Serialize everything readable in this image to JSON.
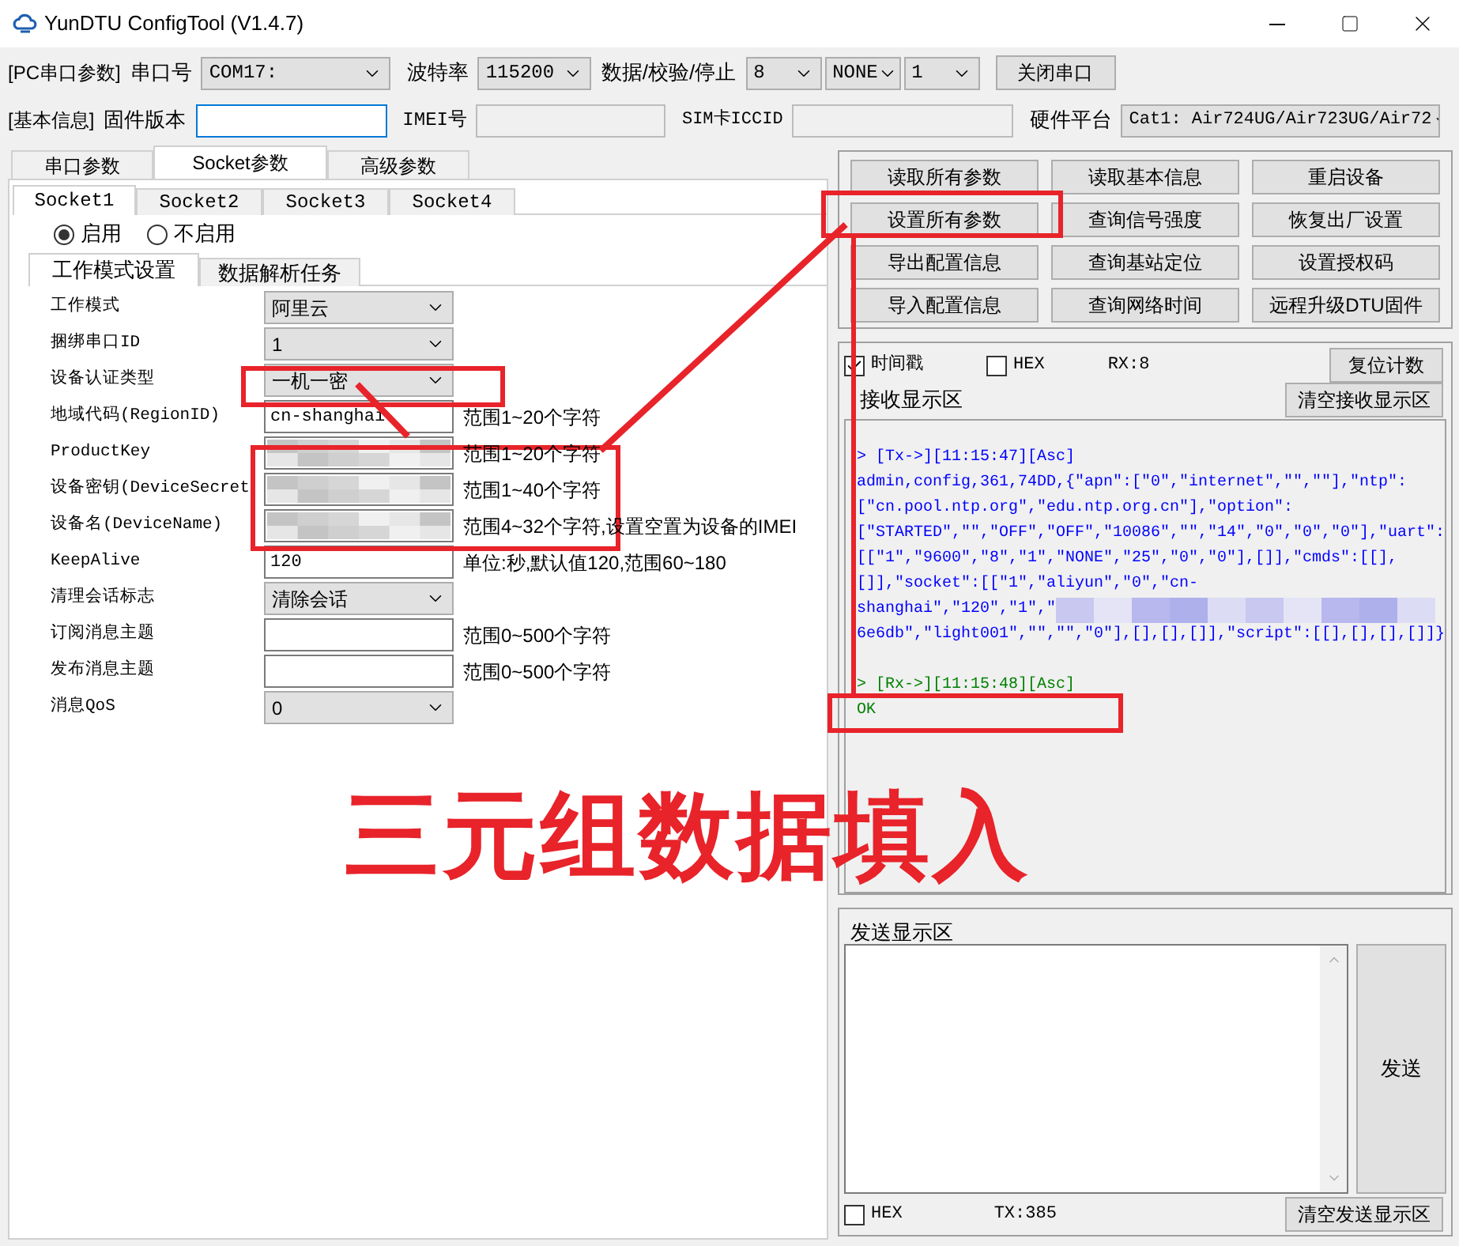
{
  "window": {
    "title": "YunDTU ConfigTool (V1.4.7)"
  },
  "serial_bar": {
    "section": "[PC串口参数]",
    "port_label": "串口号",
    "port": "COM17:",
    "baud_label": "波特率",
    "baud": "115200",
    "frame_label": "数据/校验/停止",
    "data_bits": "8",
    "parity": "NONE",
    "stop_bits": "1",
    "button": "关闭串口"
  },
  "info_bar": {
    "section": "[基本信息]",
    "firmware_label": "固件版本",
    "imei_label": "IMEI号",
    "iccid_label": "SIM卡ICCID",
    "platform_label": "硬件平台",
    "platform": "Cat1: Air724UG/Air723UG/Air72"
  },
  "main_tabs": [
    {
      "label": "串口参数",
      "selected": false
    },
    {
      "label": "Socket参数",
      "selected": true
    },
    {
      "label": "高级参数",
      "selected": false
    }
  ],
  "socket_tabs": [
    {
      "label": "Socket1",
      "selected": true
    },
    {
      "label": "Socket2",
      "selected": false
    },
    {
      "label": "Socket3",
      "selected": false
    },
    {
      "label": "Socket4",
      "selected": false
    }
  ],
  "enable_radios": [
    {
      "label": "启用",
      "selected": true
    },
    {
      "label": "不启用",
      "selected": false
    }
  ],
  "sub_tabs": [
    {
      "label": "工作模式设置",
      "selected": true
    },
    {
      "label": "数据解析任务",
      "selected": false
    }
  ],
  "form": [
    {
      "kind": "select",
      "label": "工作模式",
      "value": "阿里云"
    },
    {
      "kind": "select",
      "label": "捆绑串口ID",
      "value": "1"
    },
    {
      "kind": "select",
      "label": "设备认证类型",
      "value": "一机一密"
    },
    {
      "kind": "input",
      "label": "地域代码(RegionID)",
      "value": "cn-shanghai",
      "hint": "范围1~20个字符"
    },
    {
      "kind": "input",
      "label": "ProductKey",
      "blurred": true,
      "hint": "范围1~20个字符"
    },
    {
      "kind": "input",
      "label": "设备密钥(DeviceSecret",
      "blurred": true,
      "hint": "范围1~40个字符"
    },
    {
      "kind": "input",
      "label": "设备名(DeviceName)",
      "blurred": true,
      "hint": "范围4~32个字符,设置空置为设备的IMEI"
    },
    {
      "kind": "input",
      "label": "KeepAlive",
      "value": "120",
      "hint": "单位:秒,默认值120,范围60~180"
    },
    {
      "kind": "select",
      "label": "清理会话标志",
      "value": "清除会话"
    },
    {
      "kind": "input",
      "label": "订阅消息主题",
      "hint": "范围0~500个字符"
    },
    {
      "kind": "input",
      "label": "发布消息主题",
      "hint": "范围0~500个字符"
    },
    {
      "kind": "select",
      "label": "消息QoS",
      "value": "0"
    }
  ],
  "action_buttons": [
    "读取所有参数",
    "读取基本信息",
    "重启设备",
    "设置所有参数",
    "查询信号强度",
    "恢复出厂设置",
    "导出配置信息",
    "查询基站定位",
    "设置授权码",
    "导入配置信息",
    "查询网络时间",
    "远程升级DTU固件"
  ],
  "receive": {
    "timestamp": {
      "label": "时间戳",
      "checked": true
    },
    "hex": {
      "label": "HEX",
      "checked": false
    },
    "rx": "RX:8",
    "reset_button": "复位计数",
    "title": "接收显示区",
    "clear_button": "清空接收显示区",
    "log": [
      {
        "kind": "tx",
        "text": "> [Tx->][11:15:47][Asc]"
      },
      {
        "kind": "tx",
        "text": "admin,config,361,74DD,{\"apn\":[\"0\",\"internet\",\"\",\"\"],\"ntp\":"
      },
      {
        "kind": "tx",
        "text": "[\"cn.pool.ntp.org\",\"edu.ntp.org.cn\"],\"option\":"
      },
      {
        "kind": "tx",
        "text": "[\"STARTED\",\"\",\"OFF\",\"OFF\",\"10086\",\"\",\"14\",\"0\",\"0\",\"0\"],\"uart\":"
      },
      {
        "kind": "tx",
        "text": "[[\"1\",\"9600\",\"8\",\"1\",\"NONE\",\"25\",\"0\",\"0\"],[]],\"cmds\":[[],"
      },
      {
        "kind": "tx",
        "text": "[]],\"socket\":[[\"1\",\"aliyun\",\"0\",\"cn-"
      },
      {
        "kind": "tx",
        "text": "shanghai\",\"120\",\"1\",\"",
        "blurred": true
      },
      {
        "kind": "tx",
        "text": "6e6db\",\"light001\",\"\",\"\",\"0\"],[],[],[]],\"script\":[[],[],[],[]]}"
      },
      {
        "kind": "gap"
      },
      {
        "kind": "rx",
        "text": "> [Rx->][11:15:48][Asc]"
      },
      {
        "kind": "rx",
        "text": "OK"
      }
    ]
  },
  "send": {
    "title": "发送显示区",
    "send_button": "发送",
    "hex": {
      "label": "HEX",
      "checked": false
    },
    "tx": "TX:385",
    "clear_button": "清空发送显示区"
  },
  "annotation": {
    "caption": "三元组数据填入"
  }
}
